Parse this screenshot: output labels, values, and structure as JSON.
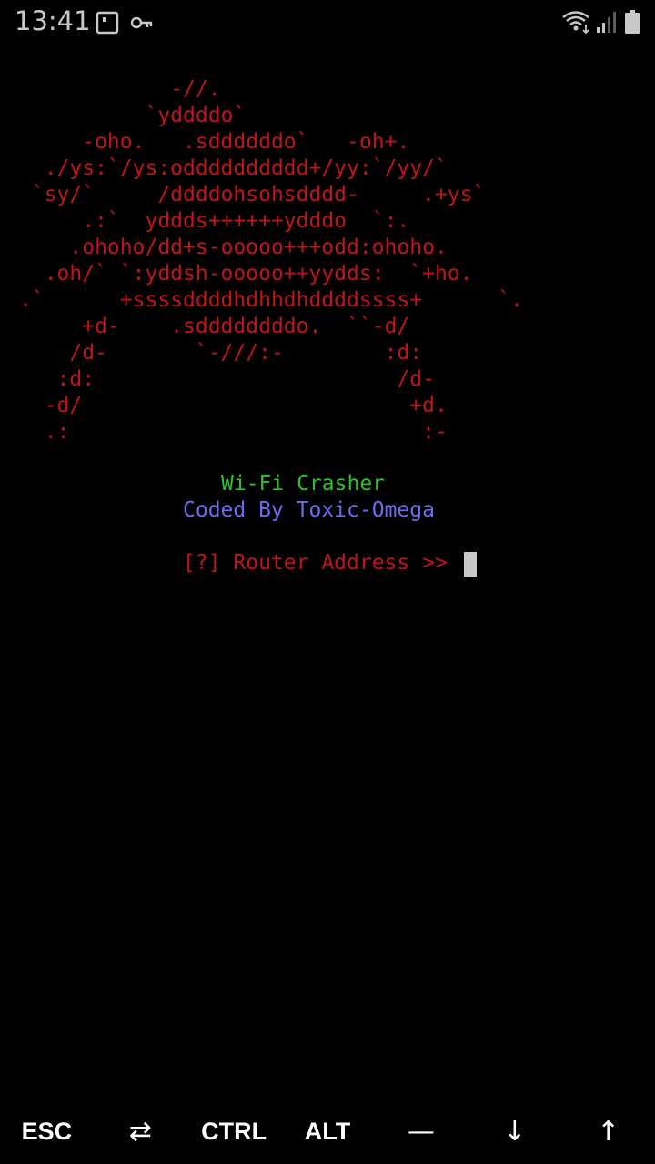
{
  "status_bar": {
    "time": "13:41",
    "left_icons": [
      "screenshot-frame-icon",
      "key-icon"
    ],
    "right_icons": [
      "wifi-icon",
      "signal-icon",
      "battery-icon"
    ]
  },
  "terminal": {
    "ascii_color": "#c0141b",
    "ascii_art": "            -//.\n          `yddddo`\n     -oho.   .sddddddo`   -oh+.\n  ./ys:`/ys:odddddddddd+/yy:`/yy/`\n `sy/`     /ddddohsohsdddd-     .+ys`\n     .:`  yddds++++++ydddo  `:.\n    .ohoho/dd+s-ooooo+++odd:ohoho.\n  .oh/` `:yddsh-ooooo++yydds:  `+ho.\n.`      +ssssddddhdhhdhddddssss+      `.\n     +d-    .sddddddddo.  ``-d/\n    /d-       `-///:-        :d:\n   :d:                        /d-\n  -d/                          +d.\n  .:                            :-",
    "title": "Wi-Fi Crasher",
    "title_color": "#2bc22a",
    "credit": "Coded By Toxic-Omega",
    "credit_color": "#6a6cf0",
    "prompt": "[?] Router Address >> "
  },
  "extra_keys": [
    {
      "label": "ESC",
      "icon": "esc-key"
    },
    {
      "label": "⇄",
      "icon": "tab-arrows-icon"
    },
    {
      "label": "CTRL",
      "icon": "ctrl-key"
    },
    {
      "label": "ALT",
      "icon": "alt-key"
    },
    {
      "label": "—",
      "icon": "dash-icon"
    },
    {
      "label": "↓",
      "icon": "arrow-down-icon"
    },
    {
      "label": "↑",
      "icon": "arrow-up-icon"
    }
  ]
}
